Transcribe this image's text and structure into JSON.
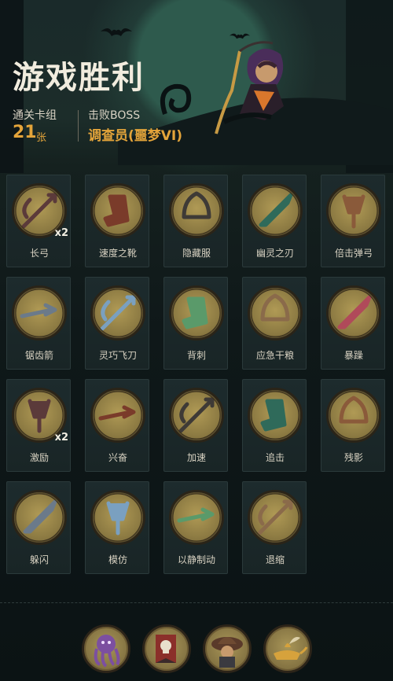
{
  "header": {
    "title": "游戏胜利",
    "deck_label": "通关卡组",
    "deck_count": "21",
    "deck_unit": "张",
    "boss_label": "击败BOSS",
    "boss_name": "调查员(噩梦VI)"
  },
  "cards": [
    {
      "name": "长弓",
      "icon": "longbow-icon",
      "multiplier": "x2"
    },
    {
      "name": "速度之靴",
      "icon": "boots-icon",
      "multiplier": ""
    },
    {
      "name": "隐藏服",
      "icon": "hooded-cloak-icon",
      "multiplier": ""
    },
    {
      "name": "幽灵之刃",
      "icon": "ghost-blade-icon",
      "multiplier": ""
    },
    {
      "name": "倍击弹弓",
      "icon": "slingshot-icon",
      "multiplier": ""
    },
    {
      "name": "锯齿箭",
      "icon": "serrated-arrow-icon",
      "multiplier": ""
    },
    {
      "name": "灵巧飞刀",
      "icon": "throwing-knives-icon",
      "multiplier": ""
    },
    {
      "name": "背刺",
      "icon": "backstab-icon",
      "multiplier": ""
    },
    {
      "name": "应急干粮",
      "icon": "rations-icon",
      "multiplier": ""
    },
    {
      "name": "暴躁",
      "icon": "rage-icon",
      "multiplier": ""
    },
    {
      "name": "激励",
      "icon": "inspire-icon",
      "multiplier": "x2"
    },
    {
      "name": "兴奋",
      "icon": "excite-icon",
      "multiplier": ""
    },
    {
      "name": "加速",
      "icon": "haste-icon",
      "multiplier": ""
    },
    {
      "name": "追击",
      "icon": "pursuit-icon",
      "multiplier": ""
    },
    {
      "name": "残影",
      "icon": "afterimage-icon",
      "multiplier": ""
    },
    {
      "name": "躲闪",
      "icon": "dodge-icon",
      "multiplier": ""
    },
    {
      "name": "模仿",
      "icon": "mimic-icon",
      "multiplier": ""
    },
    {
      "name": "以静制动",
      "icon": "stillness-icon",
      "multiplier": ""
    },
    {
      "name": "退缩",
      "icon": "retreat-icon",
      "multiplier": ""
    }
  ],
  "relics": [
    {
      "icon": "octopus-relic-icon"
    },
    {
      "icon": "skull-banner-relic-icon"
    },
    {
      "icon": "hat-figure-relic-icon"
    },
    {
      "icon": "magic-lamp-relic-icon"
    }
  ],
  "colors": {
    "accent": "#e3a43a",
    "coin": "#9c8749",
    "background": "#0f1a1c"
  }
}
